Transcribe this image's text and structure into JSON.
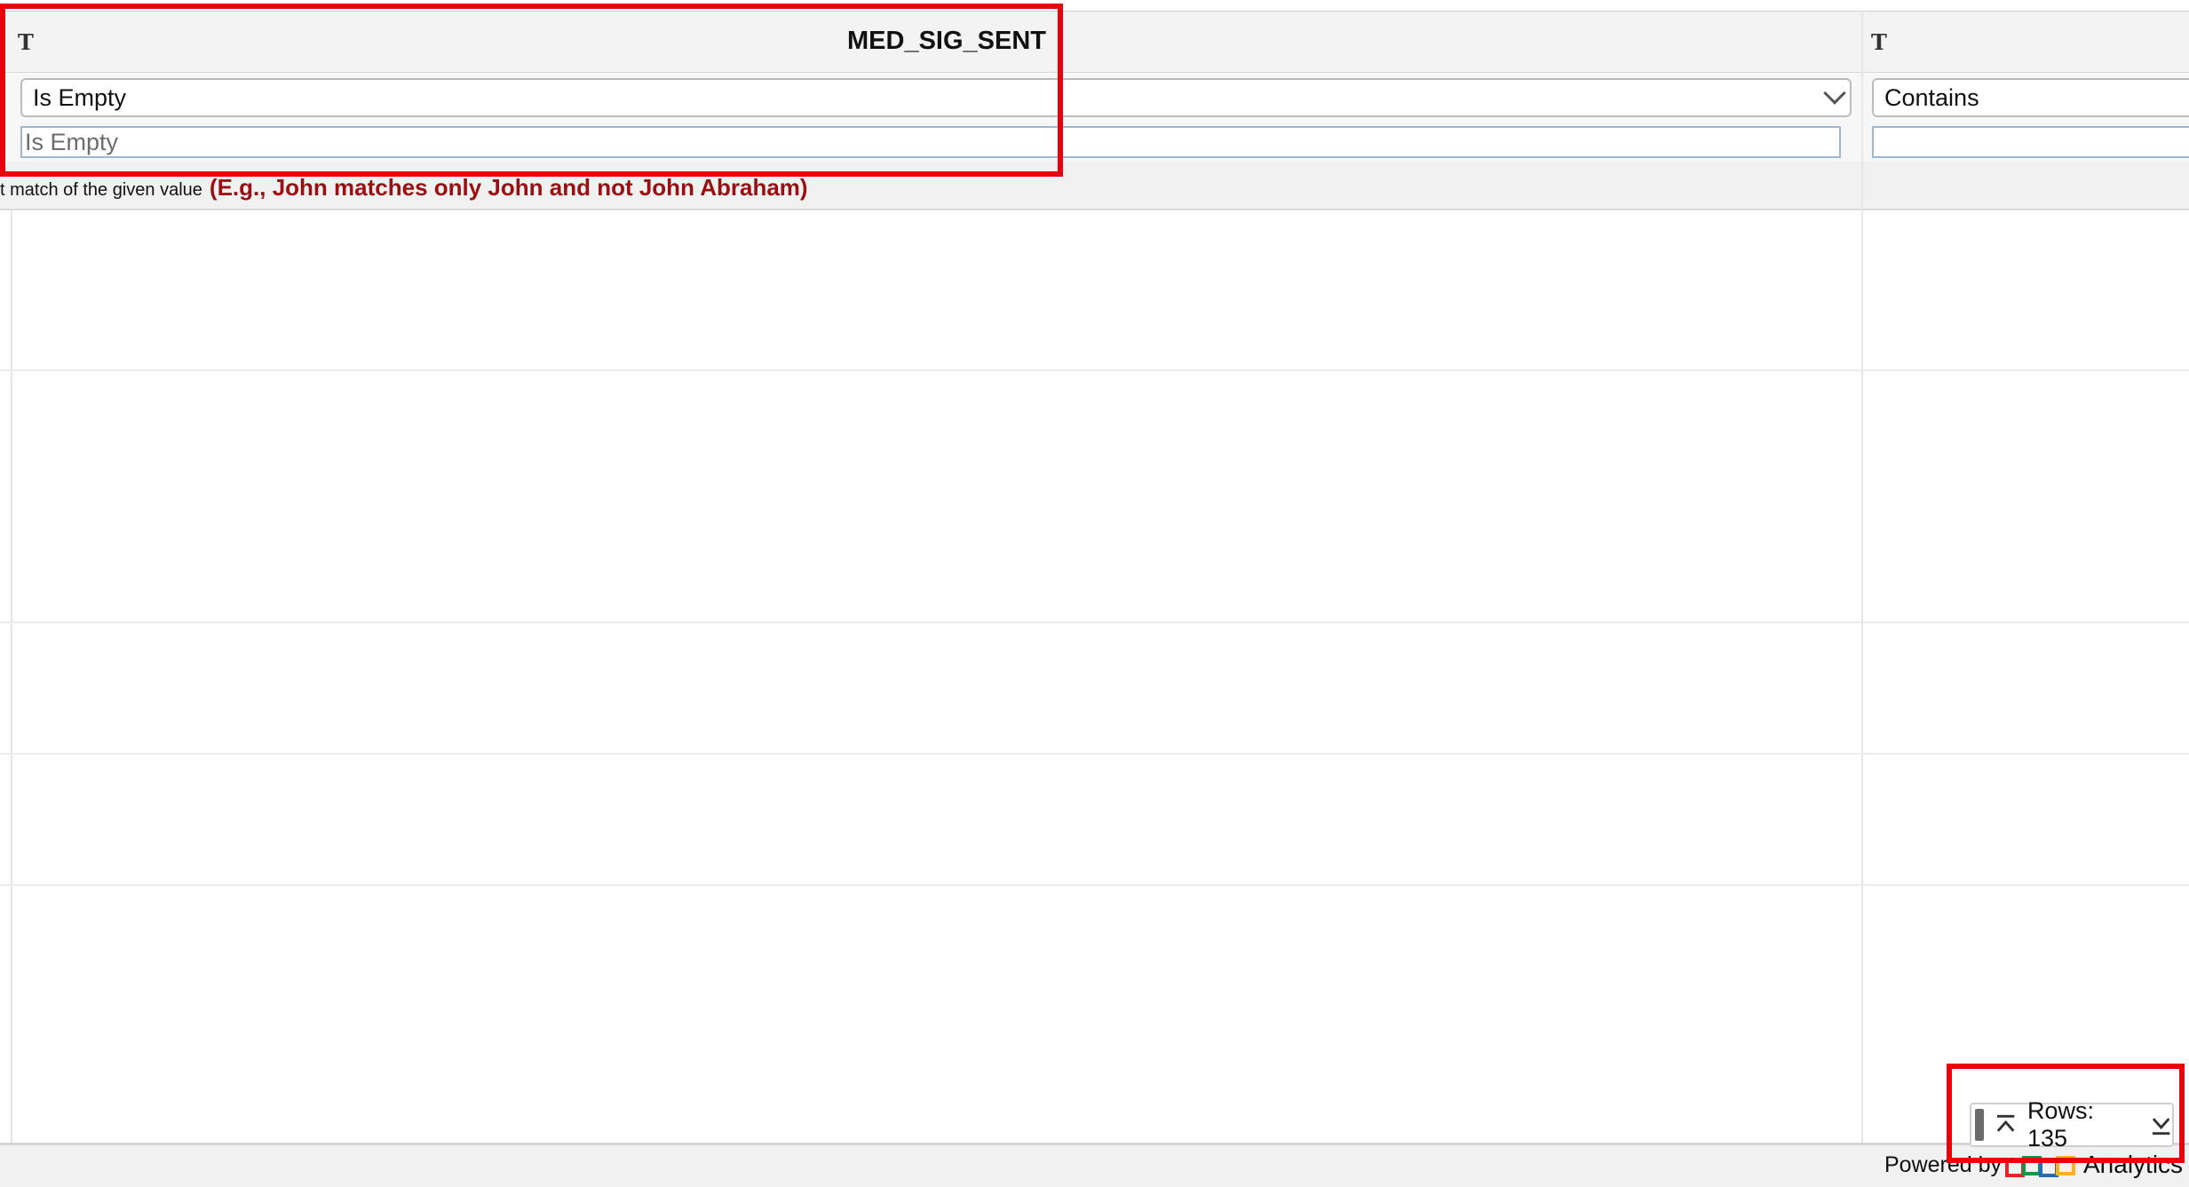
{
  "columns": [
    {
      "type_icon": "T",
      "title": "MED_SIG_SENT",
      "filter_operator": "Is Empty",
      "filter_value_placeholder": "Is Empty",
      "filter_value": ""
    },
    {
      "type_icon": "T",
      "title": "",
      "filter_operator": "Contains",
      "filter_value": ""
    }
  ],
  "hint": {
    "prefix": "t match of the given value",
    "example": "(E.g., John matches only John and not John Abraham)"
  },
  "rows_indicator": {
    "label": "Rows: 135",
    "first_icon": "scroll-top-icon",
    "last_icon": "scroll-bottom-icon"
  },
  "footer": {
    "powered_by": "Powered by",
    "brand": "Analytics"
  },
  "colors": {
    "highlight": "#e8000b",
    "hint_red": "#9b0f12"
  }
}
